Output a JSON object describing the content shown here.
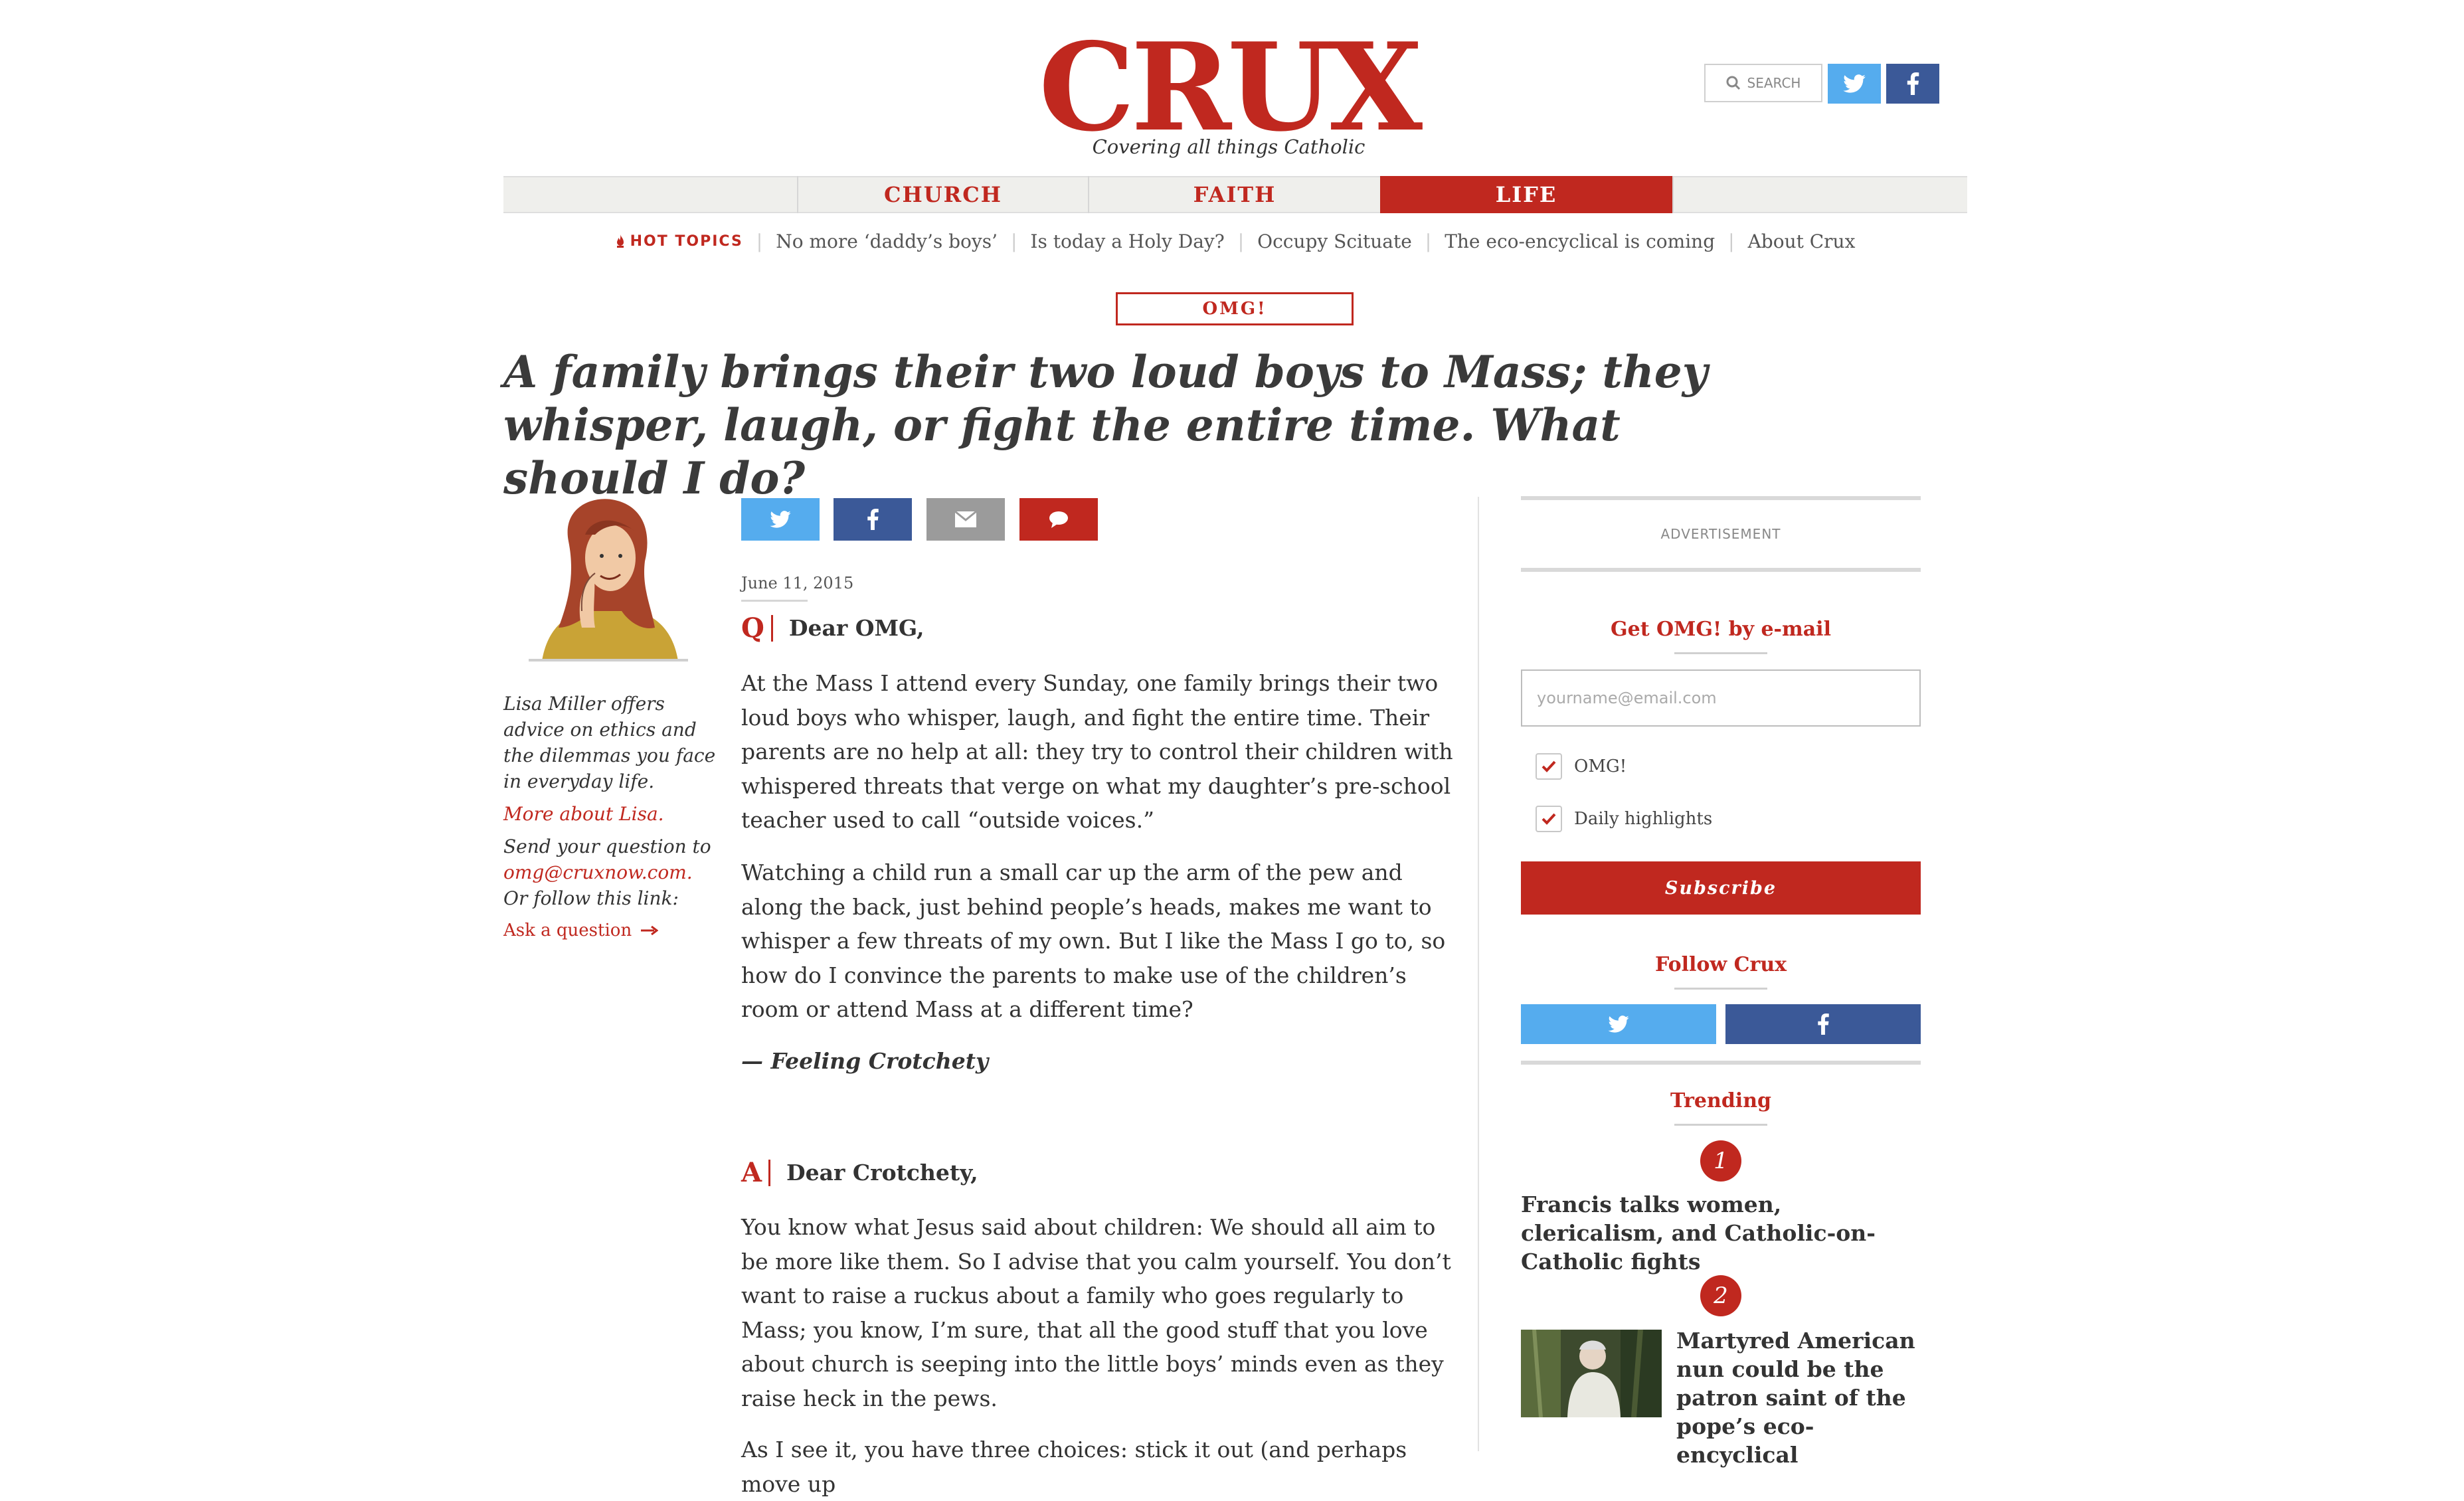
{
  "site": {
    "logo": "CRUX",
    "tagline": "Covering all things Catholic",
    "search_label": "SEARCH"
  },
  "nav": {
    "items": [
      {
        "label": "CHURCH",
        "active": false
      },
      {
        "label": "FAITH",
        "active": false
      },
      {
        "label": "LIFE",
        "active": true
      }
    ]
  },
  "hot_topics": {
    "label": "HOT TOPICS",
    "links": [
      "No more ‘daddy’s boys’",
      "Is today a Holy Day?",
      "Occupy Scituate",
      "The eco-encyclical is coming",
      "About Crux"
    ]
  },
  "article": {
    "section_tag": "OMG!",
    "headline": "A family brings their two loud boys to Mass; they whisper, laugh, or fight the entire time. What should I do?",
    "date": "June 11, 2015",
    "question": {
      "letter": "Q",
      "greeting": "Dear OMG,",
      "paragraphs": [
        "At the Mass I attend every Sunday, one family brings their two loud boys who whisper, laugh, and fight the entire time. Their parents are no help at all: they try to control their children with whispered threats that verge on what my daughter’s pre-school teacher used to call “outside voices.”",
        "Watching a child run a small car up the arm of the pew and along the back, just behind people’s heads, makes me want to whisper a few threats of my own. But I like the Mass I go to, so how do I convince the parents to make use of the children’s room or attend Mass at a different time?"
      ],
      "signoff": "— Feeling Crotchety"
    },
    "answer": {
      "letter": "A",
      "greeting": "Dear Crotchety,",
      "paragraphs": [
        "You know what Jesus said about children: We should all aim to be more like them. So I advise that you calm yourself. You don’t want to raise a ruckus about a family who goes regularly to Mass; you know, I’m sure, that all the good stuff that you love about church is seeping into the little boys’ minds even as they raise heck in the pews.",
        "As I see it, you have three choices: stick it out (and perhaps move up"
      ]
    }
  },
  "author": {
    "bio": "Lisa Miller offers advice on ethics and the dilemmas you face in everyday life.",
    "more_link": "More about Lisa.",
    "send_text": "Send your question to",
    "email": "omg@cruxnow.com.",
    "follow_text": "Or follow this link:",
    "ask_link": "Ask a question"
  },
  "sidebar": {
    "ad_label": "ADVERTISEMENT",
    "newsletter_heading": "Get OMG! by e-mail",
    "email_placeholder": "yourname@email.com",
    "options": [
      {
        "label": "OMG!",
        "checked": true
      },
      {
        "label": "Daily highlights",
        "checked": true
      }
    ],
    "subscribe_label": "Subscribe",
    "follow_heading": "Follow Crux",
    "trending_heading": "Trending",
    "trending": [
      {
        "rank": "1",
        "title": "Francis talks women, clericalism, and Catholic-on-Catholic fights"
      },
      {
        "rank": "2",
        "title": "Martyred American nun could be the patron saint of the pope’s eco-encyclical"
      }
    ]
  },
  "colors": {
    "brand_red": "#c0281f",
    "twitter": "#55acee",
    "facebook": "#3b5998",
    "email_gray": "#9b9b9b",
    "nav_bg": "#efefec"
  }
}
